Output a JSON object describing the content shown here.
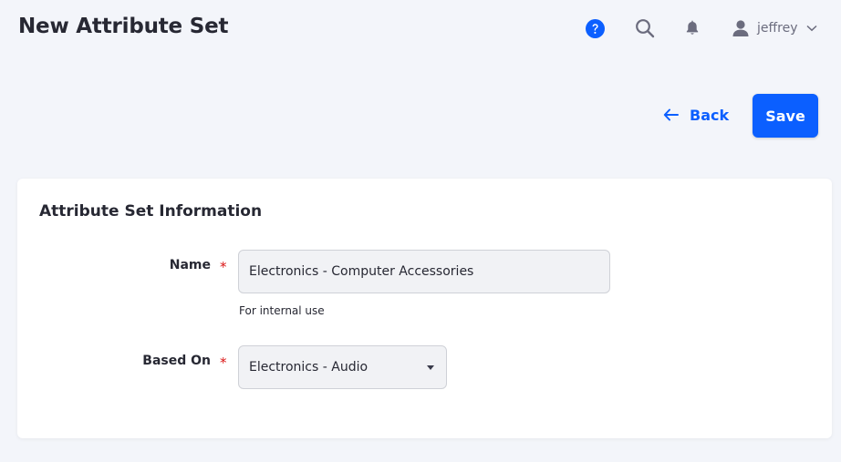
{
  "header": {
    "title": "New Attribute Set",
    "user": {
      "name": "jeffrey"
    },
    "icons": [
      "help-icon",
      "search-icon",
      "bell-icon",
      "user-icon",
      "chevron-down-icon"
    ]
  },
  "toolbar": {
    "back_label": "Back",
    "save_label": "Save"
  },
  "card": {
    "title": "Attribute Set Information",
    "fields": {
      "name": {
        "label": "Name",
        "required_mark": "*",
        "value": "Electronics - Computer Accessories",
        "help": "For internal use"
      },
      "based_on": {
        "label": "Based On",
        "required_mark": "*",
        "value": "Electronics - Audio"
      }
    }
  },
  "colors": {
    "accent": "#0b5fff",
    "background": "#f3f5fa",
    "required": "#da1414",
    "input_bg": "#f1f2f5"
  }
}
